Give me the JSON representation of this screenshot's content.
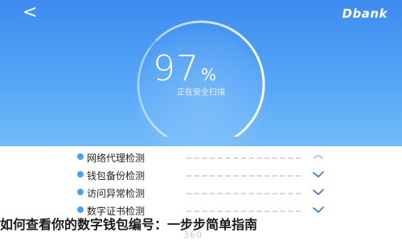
{
  "header": {
    "back_glyph": "<",
    "brand": "Dbank"
  },
  "scan": {
    "score": "97",
    "unit": "%",
    "status_text": "正在安全扫描",
    "progress": 0.97
  },
  "checks": [
    {
      "label": "网络代理检测",
      "status": "pending"
    },
    {
      "label": "钱包备份检测",
      "status": "done"
    },
    {
      "label": "访问异常检测",
      "status": "done"
    },
    {
      "label": "数字证书检测",
      "status": "done"
    }
  ],
  "caption": "如何查看你的数字钱包编号：一步步简单指南",
  "bottom_mark": "360",
  "colors": {
    "hero_top": "#3d8cf0",
    "hero_bottom": "#73bbfb",
    "accent": "#4a9ff5"
  }
}
